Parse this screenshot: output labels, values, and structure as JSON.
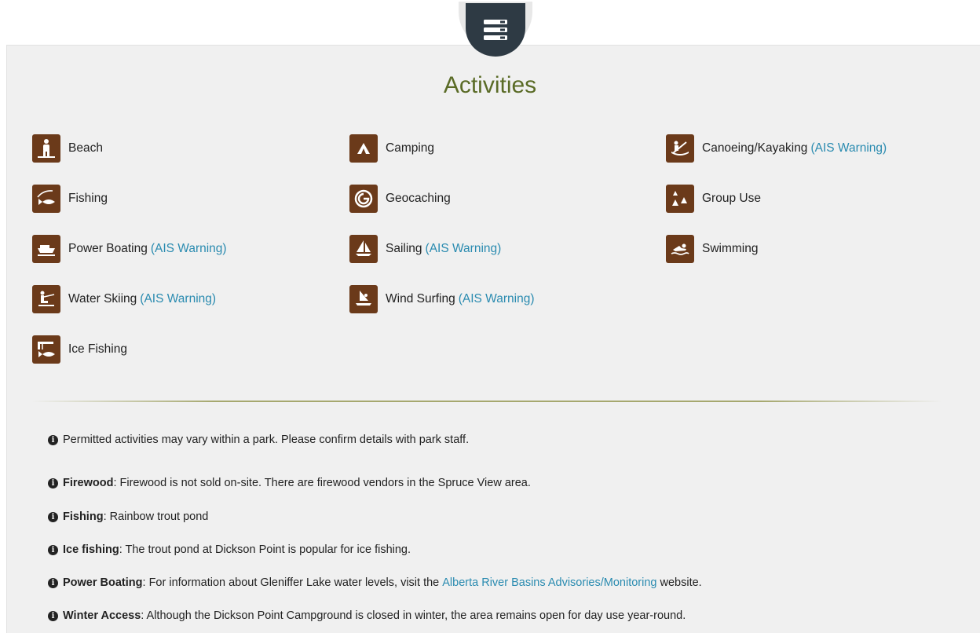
{
  "section": {
    "title": "Activities"
  },
  "activities": [
    {
      "label": "Beach",
      "icon": "beach-icon",
      "warning": ""
    },
    {
      "label": "Camping",
      "icon": "tent-icon",
      "warning": ""
    },
    {
      "label": "Canoeing/Kayaking",
      "icon": "canoe-icon",
      "warning": "(AIS Warning)"
    },
    {
      "label": "Fishing",
      "icon": "fishing-icon",
      "warning": ""
    },
    {
      "label": "Geocaching",
      "icon": "geocache-icon",
      "warning": ""
    },
    {
      "label": "Group Use",
      "icon": "group-camp-icon",
      "warning": ""
    },
    {
      "label": "Power Boating",
      "icon": "power-boat-icon",
      "warning": "(AIS Warning)"
    },
    {
      "label": "Sailing",
      "icon": "sailboat-icon",
      "warning": "(AIS Warning)"
    },
    {
      "label": "Swimming",
      "icon": "swimmer-icon",
      "warning": ""
    },
    {
      "label": "Water Skiing",
      "icon": "water-ski-icon",
      "warning": "(AIS Warning)"
    },
    {
      "label": "Wind Surfing",
      "icon": "windsurf-icon",
      "warning": "(AIS Warning)"
    },
    {
      "label": "Ice Fishing",
      "icon": "ice-fishing-icon",
      "warning": ""
    }
  ],
  "notes": [
    {
      "heading": "",
      "text": "Permitted activities may vary within a park. Please confirm details with park staff.",
      "link": "",
      "after": ""
    },
    {
      "heading": "Firewood",
      "text": ": Firewood is not sold on-site. There are firewood vendors in the Spruce View area.",
      "link": "",
      "after": ""
    },
    {
      "heading": "Fishing",
      "text": ": Rainbow trout pond",
      "link": "",
      "after": ""
    },
    {
      "heading": "Ice fishing",
      "text": ": The trout pond at Dickson Point is popular for ice fishing.",
      "link": "",
      "after": ""
    },
    {
      "heading": "Power Boating",
      "text": ": For information about Gleniffer Lake water levels, visit the ",
      "link": "Alberta River Basins Advisories/Monitoring",
      "after": " website."
    },
    {
      "heading": "Winter Access",
      "text": ": Although the Dickson Point Campground is closed in winter, the area remains open for day use year-round.",
      "link": "",
      "after": ""
    }
  ],
  "colors": {
    "accent": "#5a6b26",
    "icon_bg": "#6b3a1a",
    "link": "#2a8bb0",
    "badge": "#2e3a44"
  }
}
